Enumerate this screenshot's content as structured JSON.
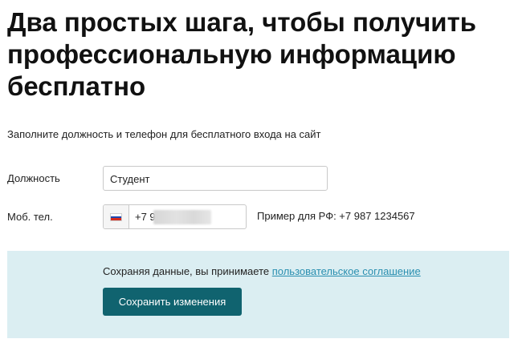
{
  "title": "Два простых шага, чтобы получить профессиональную информацию бесплатно",
  "subtitle": "Заполните должность и телефон для бесплатного входа на сайт",
  "position": {
    "label": "Должность",
    "value": "Студент"
  },
  "phone": {
    "label": "Моб. тел.",
    "prefix": "+7 9",
    "country_flag": "russia-flag-icon",
    "example": "Пример для РФ: +7 987 1234567"
  },
  "consent": {
    "text": "Сохраняя данные, вы принимаете ",
    "link_text": "пользовательское соглашение"
  },
  "save_button": "Сохранить изменения",
  "colors": {
    "panel_bg": "#dbeef2",
    "button_bg": "#10636f",
    "link": "#2a8fb0"
  }
}
